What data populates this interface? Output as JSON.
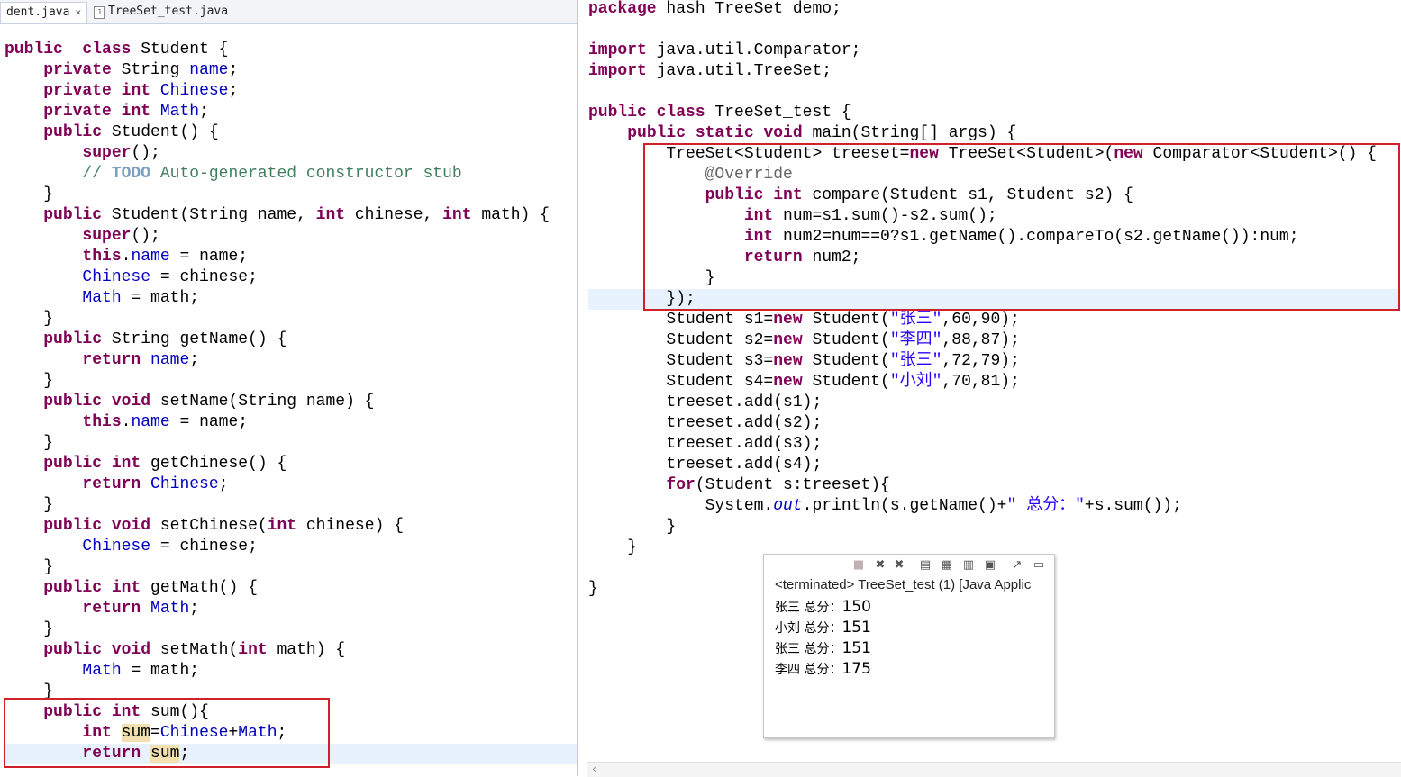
{
  "tabs": [
    {
      "label": "dent.java",
      "close": "✕",
      "active": true
    },
    {
      "label": "TreeSet_test.java",
      "active": false
    }
  ],
  "left_code": [
    {
      "parts": [
        [
          "kw",
          "public"
        ],
        [
          "",
          "  "
        ],
        [
          "kw",
          "class"
        ],
        [
          "",
          " Student {"
        ]
      ]
    },
    {
      "parts": [
        [
          "",
          "    "
        ],
        [
          "kw",
          "private"
        ],
        [
          "",
          " String "
        ],
        [
          "fld",
          "name"
        ],
        [
          "",
          ";"
        ]
      ]
    },
    {
      "parts": [
        [
          "",
          "    "
        ],
        [
          "kw",
          "private"
        ],
        [
          "",
          ""
        ],
        [
          "kw",
          " int"
        ],
        [
          "",
          " "
        ],
        [
          "fld",
          "Chinese"
        ],
        [
          "",
          ";"
        ]
      ]
    },
    {
      "parts": [
        [
          "",
          "    "
        ],
        [
          "kw",
          "private"
        ],
        [
          "kw",
          " int"
        ],
        [
          "",
          " "
        ],
        [
          "fld",
          "Math"
        ],
        [
          "",
          ";"
        ]
      ]
    },
    {
      "parts": [
        [
          "",
          "    "
        ],
        [
          "kw",
          "public"
        ],
        [
          "",
          " Student() {"
        ]
      ]
    },
    {
      "parts": [
        [
          "",
          "        "
        ],
        [
          "kw",
          "super"
        ],
        [
          "",
          "();"
        ]
      ]
    },
    {
      "parts": [
        [
          "",
          "        "
        ],
        [
          "cmt",
          "// "
        ],
        [
          "todo",
          "TODO"
        ],
        [
          "cmt",
          " Auto-generated constructor stub"
        ]
      ]
    },
    {
      "parts": [
        [
          "",
          "    }"
        ]
      ]
    },
    {
      "parts": [
        [
          "",
          "    "
        ],
        [
          "kw",
          "public"
        ],
        [
          "",
          " Student(String name, "
        ],
        [
          "kw",
          "int"
        ],
        [
          "",
          " chinese, "
        ],
        [
          "kw",
          "int"
        ],
        [
          "",
          " math) {"
        ]
      ]
    },
    {
      "parts": [
        [
          "",
          "        "
        ],
        [
          "kw",
          "super"
        ],
        [
          "",
          "();"
        ]
      ]
    },
    {
      "parts": [
        [
          "",
          "        "
        ],
        [
          "kw",
          "this"
        ],
        [
          "",
          "."
        ],
        [
          "fld",
          "name"
        ],
        [
          "",
          " = name;"
        ]
      ]
    },
    {
      "parts": [
        [
          "",
          "        "
        ],
        [
          "fld",
          "Chinese"
        ],
        [
          "",
          " = chinese;"
        ]
      ]
    },
    {
      "parts": [
        [
          "",
          "        "
        ],
        [
          "fld",
          "Math"
        ],
        [
          "",
          " = math;"
        ]
      ]
    },
    {
      "parts": [
        [
          "",
          "    }"
        ]
      ]
    },
    {
      "parts": [
        [
          "",
          "    "
        ],
        [
          "kw",
          "public"
        ],
        [
          "",
          " String getName() {"
        ]
      ]
    },
    {
      "parts": [
        [
          "",
          "        "
        ],
        [
          "kw",
          "return"
        ],
        [
          "",
          " "
        ],
        [
          "fld",
          "name"
        ],
        [
          "",
          ";"
        ]
      ]
    },
    {
      "parts": [
        [
          "",
          "    }"
        ]
      ]
    },
    {
      "parts": [
        [
          "",
          "    "
        ],
        [
          "kw",
          "public"
        ],
        [
          "kw",
          " void"
        ],
        [
          "",
          " setName(String name) {"
        ]
      ]
    },
    {
      "parts": [
        [
          "",
          "        "
        ],
        [
          "kw",
          "this"
        ],
        [
          "",
          "."
        ],
        [
          "fld",
          "name"
        ],
        [
          "",
          " = name;"
        ]
      ]
    },
    {
      "parts": [
        [
          "",
          "    }"
        ]
      ]
    },
    {
      "parts": [
        [
          "",
          "    "
        ],
        [
          "kw",
          "public"
        ],
        [
          "kw",
          " int"
        ],
        [
          "",
          " getChinese() {"
        ]
      ]
    },
    {
      "parts": [
        [
          "",
          "        "
        ],
        [
          "kw",
          "return"
        ],
        [
          "",
          " "
        ],
        [
          "fld",
          "Chinese"
        ],
        [
          "",
          ";"
        ]
      ]
    },
    {
      "parts": [
        [
          "",
          "    }"
        ]
      ]
    },
    {
      "parts": [
        [
          "",
          "    "
        ],
        [
          "kw",
          "public"
        ],
        [
          "kw",
          " void"
        ],
        [
          "",
          " setChinese("
        ],
        [
          "kw",
          "int"
        ],
        [
          "",
          " chinese) {"
        ]
      ]
    },
    {
      "parts": [
        [
          "",
          "        "
        ],
        [
          "fld",
          "Chinese"
        ],
        [
          "",
          " = chinese;"
        ]
      ]
    },
    {
      "parts": [
        [
          "",
          "    }"
        ]
      ]
    },
    {
      "parts": [
        [
          "",
          "    "
        ],
        [
          "kw",
          "public"
        ],
        [
          "kw",
          " int"
        ],
        [
          "",
          " getMath() {"
        ]
      ]
    },
    {
      "parts": [
        [
          "",
          "        "
        ],
        [
          "kw",
          "return"
        ],
        [
          "",
          " "
        ],
        [
          "fld",
          "Math"
        ],
        [
          "",
          ";"
        ]
      ]
    },
    {
      "parts": [
        [
          "",
          "    }"
        ]
      ]
    },
    {
      "parts": [
        [
          "",
          "    "
        ],
        [
          "kw",
          "public"
        ],
        [
          "kw",
          " void"
        ],
        [
          "",
          " setMath("
        ],
        [
          "kw",
          "int"
        ],
        [
          "",
          " math) {"
        ]
      ]
    },
    {
      "parts": [
        [
          "",
          "        "
        ],
        [
          "fld",
          "Math"
        ],
        [
          "",
          " = math;"
        ]
      ]
    },
    {
      "parts": [
        [
          "",
          "    }"
        ]
      ]
    },
    {
      "parts": [
        [
          "",
          "    "
        ],
        [
          "kw",
          "public"
        ],
        [
          "kw",
          " int"
        ],
        [
          "",
          " sum(){"
        ]
      ]
    },
    {
      "parts": [
        [
          "",
          "        "
        ],
        [
          "kw",
          "int"
        ],
        [
          "",
          " "
        ],
        [
          "hl",
          "sum"
        ],
        [
          "",
          "="
        ],
        [
          "fld",
          "Chinese"
        ],
        [
          "",
          "+"
        ],
        [
          "fld",
          "Math"
        ],
        [
          "",
          ";"
        ]
      ]
    },
    {
      "parts": [
        [
          "",
          "        "
        ],
        [
          "kw",
          "return"
        ],
        [
          "",
          " "
        ],
        [
          "hl",
          "sum"
        ],
        [
          "",
          ";"
        ]
      ],
      "current": true
    }
  ],
  "right_code": [
    {
      "parts": [
        [
          "kw",
          "package"
        ],
        [
          "",
          " hash_TreeSet_demo;"
        ]
      ]
    },
    {
      "parts": [
        [
          "",
          ""
        ]
      ]
    },
    {
      "parts": [
        [
          "kw",
          "import"
        ],
        [
          "",
          " java.util.Comparator;"
        ]
      ]
    },
    {
      "parts": [
        [
          "kw",
          "import"
        ],
        [
          "",
          " java.util.TreeSet;"
        ]
      ]
    },
    {
      "parts": [
        [
          "",
          ""
        ]
      ]
    },
    {
      "parts": [
        [
          "kw",
          "public"
        ],
        [
          "kw",
          " class"
        ],
        [
          "",
          " TreeSet_test {"
        ]
      ]
    },
    {
      "parts": [
        [
          "",
          "    "
        ],
        [
          "kw",
          "public"
        ],
        [
          "kw",
          " static"
        ],
        [
          "kw",
          " void"
        ],
        [
          "",
          " main(String[] args) {"
        ]
      ]
    },
    {
      "parts": [
        [
          "",
          "        TreeSet<Student> treeset="
        ],
        [
          "kw",
          "new"
        ],
        [
          "",
          " TreeSet<Student>("
        ],
        [
          "kw",
          "new"
        ],
        [
          "",
          " Comparator<Student>() {"
        ]
      ]
    },
    {
      "parts": [
        [
          "",
          "            "
        ],
        [
          "ann",
          "@Override"
        ]
      ]
    },
    {
      "parts": [
        [
          "",
          "            "
        ],
        [
          "kw",
          "public"
        ],
        [
          "kw",
          " int"
        ],
        [
          "",
          " compare(Student s1, Student s2) {"
        ]
      ]
    },
    {
      "parts": [
        [
          "",
          "                "
        ],
        [
          "kw",
          "int"
        ],
        [
          "",
          " num=s1.sum()-s2.sum();"
        ]
      ]
    },
    {
      "parts": [
        [
          "",
          "                "
        ],
        [
          "kw",
          "int"
        ],
        [
          "",
          " num2=num==0?s1.getName().compareTo(s2.getName()):num;"
        ]
      ]
    },
    {
      "parts": [
        [
          "",
          "                "
        ],
        [
          "kw",
          "return"
        ],
        [
          "",
          " num2;"
        ]
      ]
    },
    {
      "parts": [
        [
          "",
          "            }"
        ]
      ]
    },
    {
      "parts": [
        [
          "",
          "        });"
        ]
      ],
      "current": true
    },
    {
      "parts": [
        [
          "",
          "        Student s1="
        ],
        [
          "kw",
          "new"
        ],
        [
          "",
          " Student("
        ],
        [
          "str",
          "\"张三\""
        ],
        [
          "",
          ",60,90);"
        ]
      ]
    },
    {
      "parts": [
        [
          "",
          "        Student s2="
        ],
        [
          "kw",
          "new"
        ],
        [
          "",
          " Student("
        ],
        [
          "str",
          "\"李四\""
        ],
        [
          "",
          ",88,87);"
        ]
      ]
    },
    {
      "parts": [
        [
          "",
          "        Student s3="
        ],
        [
          "kw",
          "new"
        ],
        [
          "",
          " Student("
        ],
        [
          "str",
          "\"张三\""
        ],
        [
          "",
          ",72,79);"
        ]
      ]
    },
    {
      "parts": [
        [
          "",
          "        Student s4="
        ],
        [
          "kw",
          "new"
        ],
        [
          "",
          " Student("
        ],
        [
          "str",
          "\"小刘\""
        ],
        [
          "",
          ",70,81);"
        ]
      ]
    },
    {
      "parts": [
        [
          "",
          "        treeset.add(s1);"
        ]
      ]
    },
    {
      "parts": [
        [
          "",
          "        treeset.add(s2);"
        ]
      ]
    },
    {
      "parts": [
        [
          "",
          "        treeset.add(s3);"
        ]
      ]
    },
    {
      "parts": [
        [
          "",
          "        treeset.add(s4);"
        ]
      ]
    },
    {
      "parts": [
        [
          "",
          "        "
        ],
        [
          "kw",
          "for"
        ],
        [
          "",
          "(Student s:treeset){"
        ]
      ]
    },
    {
      "parts": [
        [
          "",
          "            System."
        ],
        [
          "it",
          "out"
        ],
        [
          "",
          ".println(s.getName()+"
        ],
        [
          "str",
          "\" 总分：\""
        ],
        [
          "",
          "+s.sum());"
        ]
      ]
    },
    {
      "parts": [
        [
          "",
          "        }"
        ]
      ]
    },
    {
      "parts": [
        [
          "",
          "    }"
        ]
      ]
    },
    {
      "parts": [
        [
          "",
          ""
        ]
      ]
    },
    {
      "parts": [
        [
          "",
          "}"
        ]
      ]
    }
  ],
  "console": {
    "status": "<terminated> TreeSet_test (1) [Java Applic",
    "output": [
      {
        "label": "张三 总分：",
        "value": "150"
      },
      {
        "label": "小刘 总分：",
        "value": "151"
      },
      {
        "label": "张三 总分：",
        "value": "151"
      },
      {
        "label": "李四 总分：",
        "value": "175"
      }
    ]
  },
  "colors": {
    "keyword": "#7f0055",
    "field": "#0000c0",
    "comment": "#3f7f5f",
    "string": "#2a00ff",
    "highlight_box": "#d0202a"
  }
}
